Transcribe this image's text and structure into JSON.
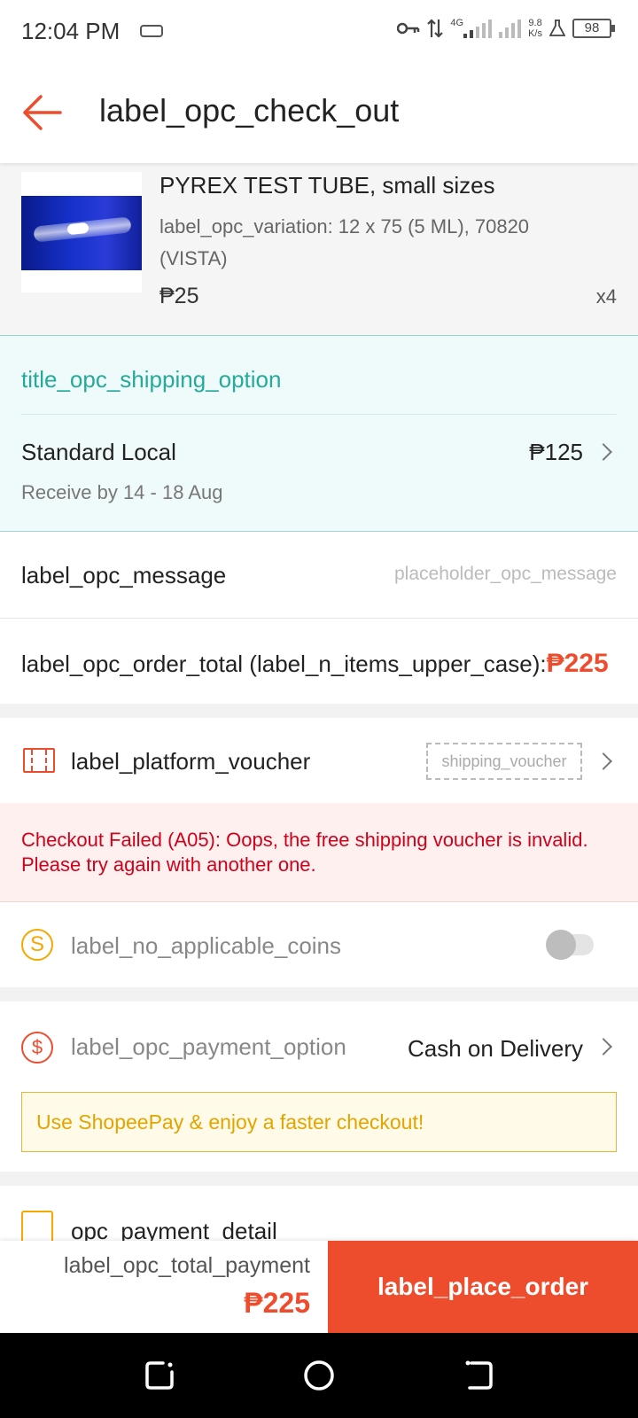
{
  "status_bar": {
    "time": "12:04 PM",
    "network": "4G",
    "speed_value": "9.8",
    "speed_unit": "K/s",
    "battery": "98"
  },
  "app_bar": {
    "title": "label_opc_check_out",
    "back_icon": "arrow-left-icon"
  },
  "product": {
    "name": "PYREX TEST TUBE, small sizes",
    "variation": "label_opc_variation: 12 x 75 (5 ML), 70820 (VISTA)",
    "price": "₱25",
    "quantity": "x4"
  },
  "shipping": {
    "title": "title_opc_shipping_option",
    "method": "Standard Local",
    "price": "₱125",
    "receive_by": "Receive by 14 - 18 Aug"
  },
  "message": {
    "label": "label_opc_message",
    "placeholder": "placeholder_opc_message",
    "value": ""
  },
  "order_total": {
    "label": "label_opc_order_total (label_n_items_upper_case):",
    "amount": "₱225"
  },
  "voucher": {
    "label": "label_platform_voucher",
    "chip": "shipping_voucher"
  },
  "error": {
    "message": "Checkout Failed (A05): Oops, the free shipping voucher is invalid. Please try again with another one."
  },
  "coins": {
    "label": "label_no_applicable_coins",
    "icon_glyph": "S",
    "toggle_on": false
  },
  "payment": {
    "label": "label_opc_payment_option",
    "value": "Cash on Delivery",
    "icon_glyph": "$",
    "promo": "Use ShopeePay & enjoy a faster checkout!"
  },
  "payment_detail": {
    "label": "opc_payment_detail"
  },
  "bottom_bar": {
    "total_label": "label_opc_total_payment",
    "total_amount": "₱225",
    "place_order": "label_place_order"
  },
  "colors": {
    "brand": "#ee4d2d",
    "shipping_teal": "#26aa99",
    "error_red": "#d0011b",
    "coin_gold": "#f6a700"
  }
}
